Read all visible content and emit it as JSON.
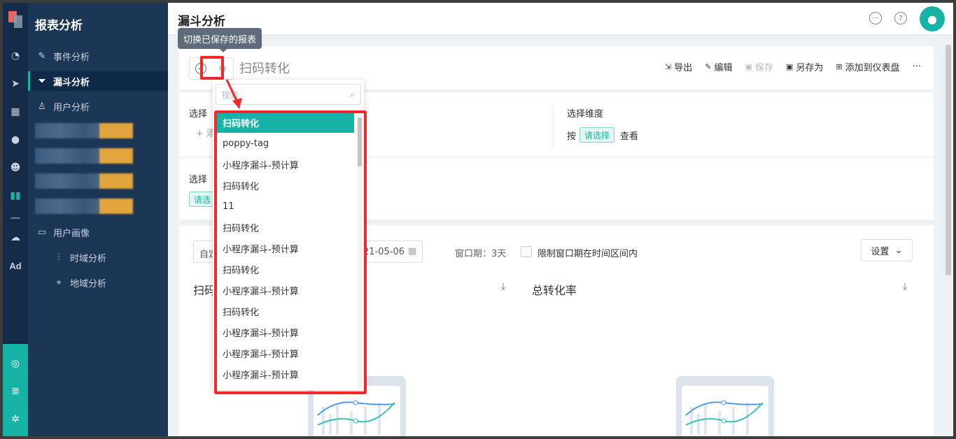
{
  "sidebar": {
    "title": "报表分析",
    "items": [
      {
        "label": "事件分析"
      },
      {
        "label": "漏斗分析"
      },
      {
        "label": "用户分析"
      },
      {
        "label": "用户画像"
      },
      {
        "label": "时域分析"
      },
      {
        "label": "地域分析"
      }
    ]
  },
  "rail": {
    "ad_label": "Ad"
  },
  "header": {
    "title": "漏斗分析"
  },
  "tooltip": {
    "text": "切换已保存的报表"
  },
  "report": {
    "title": "扫码转化"
  },
  "actions": {
    "export": "导出",
    "edit": "编辑",
    "save": "保存",
    "save_as": "另存为",
    "add_dashboard": "添加到仪表盘",
    "more": "···"
  },
  "dimension": {
    "label": "选择维度",
    "prefix": "按",
    "select_tag": "请选择",
    "suffix": "查看"
  },
  "dropdown": {
    "search_placeholder": "搜索",
    "options": [
      "扫码转化",
      "poppy-tag",
      "小程序漏斗-预计算",
      "扫码转化",
      "11",
      "扫码转化",
      "小程序漏斗-预计算",
      "扫码转化",
      "小程序漏斗-预计算",
      "扫码转化",
      "小程序漏斗-预计算",
      "小程序漏斗-预计算",
      "小程序漏斗-预计算"
    ],
    "selected_index": 0
  },
  "hidden_fragments": {
    "select_step": "选择",
    "add": "+ 添",
    "select_filter": "选择",
    "filter_tag": "请选",
    "date_prefix": "自定",
    "date_end": "21-05-06",
    "chart1_prefix": "扫码"
  },
  "window_period": "窗口期：3天",
  "limit_window": "限制窗口期在时间区间内",
  "settings_label": "设置",
  "overall_rate": "总转化率"
}
